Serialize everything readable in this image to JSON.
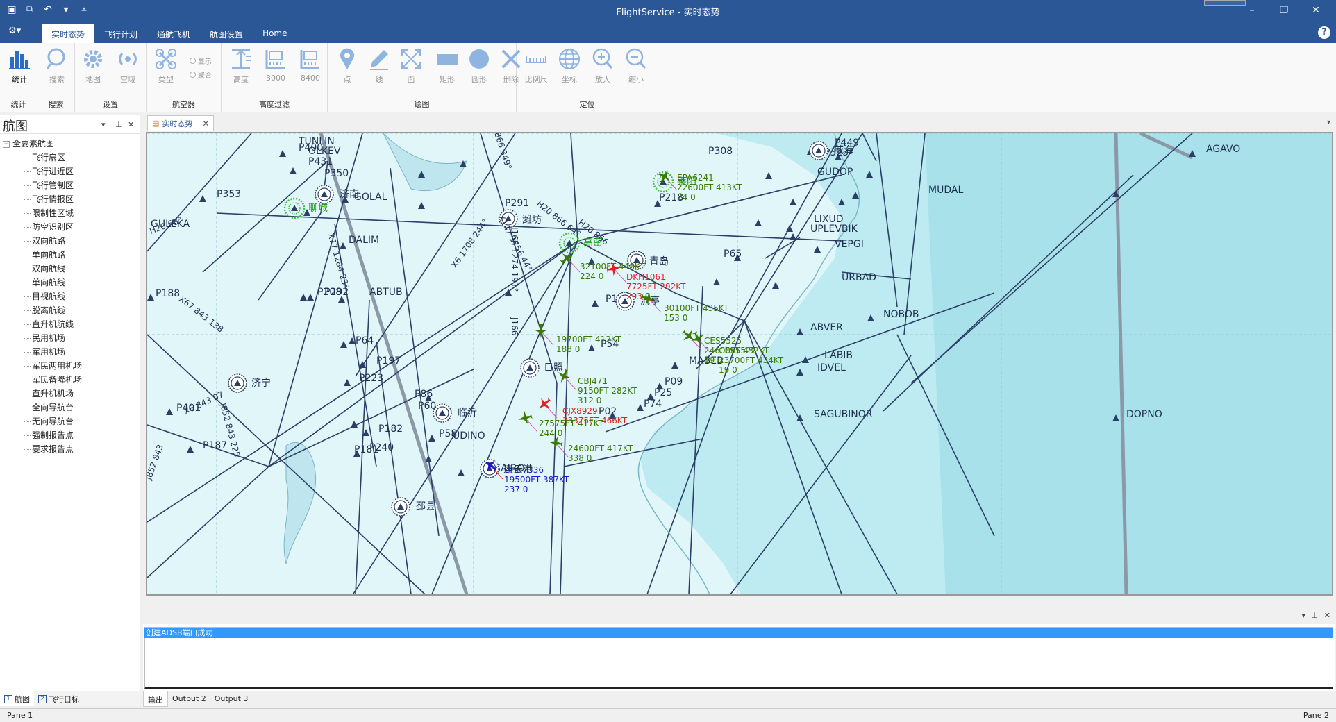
{
  "app": {
    "title": "FlightService - 实时态势",
    "qat_icons": [
      "save-icon",
      "save-all-icon",
      "undo-icon",
      "dropdown-icon",
      "customize-icon"
    ]
  },
  "ribbon": {
    "tabs": [
      {
        "label": "实时态势",
        "active": true
      },
      {
        "label": "飞行计划",
        "active": false
      },
      {
        "label": "通航飞机",
        "active": false
      },
      {
        "label": "航图设置",
        "active": false
      },
      {
        "label": "Home",
        "active": false
      }
    ],
    "groups": [
      {
        "label": "统计",
        "buttons": [
          {
            "label": "统计",
            "icon": "bar-chart-icon",
            "enabled": true
          }
        ]
      },
      {
        "label": "搜索",
        "buttons": [
          {
            "label": "搜索",
            "icon": "search-icon",
            "enabled": false
          }
        ]
      },
      {
        "label": "设置",
        "buttons": [
          {
            "label": "地图",
            "icon": "gear-icon",
            "enabled": false
          },
          {
            "label": "空域",
            "icon": "radar-icon",
            "enabled": false
          }
        ]
      },
      {
        "label": "航空器",
        "buttons": [
          {
            "label": "类型",
            "icon": "drone-icon",
            "enabled": false
          }
        ],
        "radios": [
          "显示",
          "聚合"
        ]
      },
      {
        "label": "高度过滤",
        "buttons": [
          {
            "label": "高度",
            "icon": "altitude-icon",
            "enabled": false
          },
          {
            "label": "3000",
            "icon": "ruler-icon",
            "enabled": false
          },
          {
            "label": "8400",
            "icon": "ruler-icon",
            "enabled": false
          }
        ]
      },
      {
        "label": "绘图",
        "buttons": [
          {
            "label": "点",
            "icon": "pin-icon",
            "enabled": false
          },
          {
            "label": "线",
            "icon": "pencil-icon",
            "enabled": false
          },
          {
            "label": "面",
            "icon": "expand-icon",
            "enabled": false
          },
          {
            "label": "矩形",
            "icon": "rectangle-icon",
            "enabled": false
          },
          {
            "label": "圆形",
            "icon": "circle-icon",
            "enabled": false
          },
          {
            "label": "删除",
            "icon": "delete-icon",
            "enabled": false
          }
        ]
      },
      {
        "label": "定位",
        "buttons": [
          {
            "label": "比例尺",
            "icon": "scale-icon",
            "enabled": false
          },
          {
            "label": "坐标",
            "icon": "globe-icon",
            "enabled": false
          },
          {
            "label": "放大",
            "icon": "zoom-in-icon",
            "enabled": false
          },
          {
            "label": "缩小",
            "icon": "zoom-out-icon",
            "enabled": false
          }
        ]
      }
    ]
  },
  "leftpane": {
    "title": "航图",
    "root": "全要素航图",
    "items": [
      "飞行扇区",
      "飞行进近区",
      "飞行管制区",
      "飞行情报区",
      "限制性区域",
      "防空识别区",
      "双向航路",
      "单向航路",
      "双向航线",
      "单向航线",
      "目视航线",
      "脱离航线",
      "直升机航线",
      "民用机场",
      "军用机场",
      "军民两用机场",
      "军民备降机场",
      "直升机机场",
      "全向导航台",
      "无向导航台",
      "强制报告点",
      "要求报告点"
    ],
    "tabs": [
      {
        "num": "1",
        "label": "航图"
      },
      {
        "num": "2",
        "label": "飞行目标"
      }
    ]
  },
  "document": {
    "tab_label": "实时态势"
  },
  "map": {
    "colors": {
      "land": "#e1f6f9",
      "sea_near": "#bdebf1",
      "sea_far": "#a8e1ea",
      "route": "#2a3f66",
      "flight_green": "#3a7a00",
      "flight_red": "#e02020",
      "flight_blue": "#1a1acc",
      "grid": "#9cc7d6"
    },
    "waypoints": [
      {
        "name": "P400"
      },
      {
        "name": "P431"
      },
      {
        "name": "P353"
      },
      {
        "name": "P350"
      },
      {
        "name": "GOLAL"
      },
      {
        "name": "P291"
      },
      {
        "name": "P218"
      },
      {
        "name": "P308"
      },
      {
        "name": "P449"
      },
      {
        "name": "P323"
      },
      {
        "name": "GUDOP"
      },
      {
        "name": "LIXUD"
      },
      {
        "name": "UPLEVBIK"
      },
      {
        "name": "VEPGI"
      },
      {
        "name": "P65"
      },
      {
        "name": "URBAD"
      },
      {
        "name": "DALIM"
      },
      {
        "name": "P188"
      },
      {
        "name": "P208"
      },
      {
        "name": "P292"
      },
      {
        "name": "ABTUB"
      },
      {
        "name": "P116"
      },
      {
        "name": "P64"
      },
      {
        "name": "P197"
      },
      {
        "name": "P54"
      },
      {
        "name": "MABEB"
      },
      {
        "name": "P223"
      },
      {
        "name": "P86"
      },
      {
        "name": "P60"
      },
      {
        "name": "P09"
      },
      {
        "name": "P25"
      },
      {
        "name": "P74"
      },
      {
        "name": "P02"
      },
      {
        "name": "P182"
      },
      {
        "name": "P58"
      },
      {
        "name": "UDINO"
      },
      {
        "name": "P181"
      },
      {
        "name": "P240"
      },
      {
        "name": "SAIRO"
      },
      {
        "name": "P401"
      },
      {
        "name": "P187"
      },
      {
        "name": "ABVER"
      },
      {
        "name": "LABIB"
      },
      {
        "name": "IDVEL"
      },
      {
        "name": "SAGUBINOR"
      },
      {
        "name": "NOBOB"
      },
      {
        "name": "MUDAL"
      },
      {
        "name": "AGAVO"
      },
      {
        "name": "DOPNO"
      },
      {
        "name": "GULEKA"
      },
      {
        "name": "TUNLIN"
      },
      {
        "name": "OLKEV"
      }
    ],
    "airports": [
      {
        "name": "济南"
      },
      {
        "name": "潍坊"
      },
      {
        "name": "青岛"
      },
      {
        "name": "流亭"
      },
      {
        "name": "日照"
      },
      {
        "name": "临沂"
      },
      {
        "name": "济宁"
      },
      {
        "name": "连云港"
      },
      {
        "name": "威海"
      },
      {
        "name": "邳县"
      }
    ],
    "highlighted_airports": [
      {
        "name": "聊城"
      },
      {
        "name": "莱阳"
      },
      {
        "name": "高密"
      }
    ],
    "route_labels": [
      "X6 1708 244°",
      "X147 1756 44°",
      "J166 1274 191°",
      "H20 866 64°",
      "H20 866",
      "X77 1284 23°",
      "X67 843 138",
      "J852 843 225",
      "X6 843 07",
      "J852 843",
      "H20 68°",
      "J166",
      "866 349°"
    ],
    "flights": [
      {
        "callsign": "EPA6241",
        "alt_speed": "22600FT 413KT",
        "extra": "24 0",
        "color": "green"
      },
      {
        "callsign": "",
        "alt_speed": "32100FT 448KT",
        "extra": "224 0",
        "color": "green"
      },
      {
        "callsign": "DKH1061",
        "alt_speed": "7725FT 292KT",
        "extra": "293 0",
        "color": "red"
      },
      {
        "callsign": "",
        "alt_speed": "30100FT 435KT",
        "extra": "153 0",
        "color": "green"
      },
      {
        "callsign": "CES5525",
        "alt_speed": "24600FT 432KT",
        "extra": "19 0",
        "color": "green"
      },
      {
        "callsign": "CES5527",
        "alt_speed": "23700FT 434KT",
        "extra": "19 0",
        "color": "green"
      },
      {
        "callsign": "",
        "alt_speed": "19700FT 412KT",
        "extra": "188 0",
        "color": "green"
      },
      {
        "callsign": "CBJ471",
        "alt_speed": "9150FT 282KT",
        "extra": "312 0",
        "color": "green"
      },
      {
        "callsign": "CJX8929",
        "alt_speed": "33375FT 466KT",
        "extra": "",
        "color": "red"
      },
      {
        "callsign": "",
        "alt_speed": "27575FT 417KT",
        "extra": "244 0",
        "color": "green"
      },
      {
        "callsign": "",
        "alt_speed": "24600FT 417KT",
        "extra": "338 0",
        "color": "green"
      },
      {
        "callsign": "CHH7336",
        "alt_speed": "19500FT 387KT",
        "extra": "237 0",
        "color": "blue"
      }
    ]
  },
  "output": {
    "line": "创建ADSB端口成功",
    "tabs": [
      "输出",
      "Output 2",
      "Output 3"
    ]
  },
  "status": {
    "left": "Pane 1",
    "right": "Pane 2"
  }
}
